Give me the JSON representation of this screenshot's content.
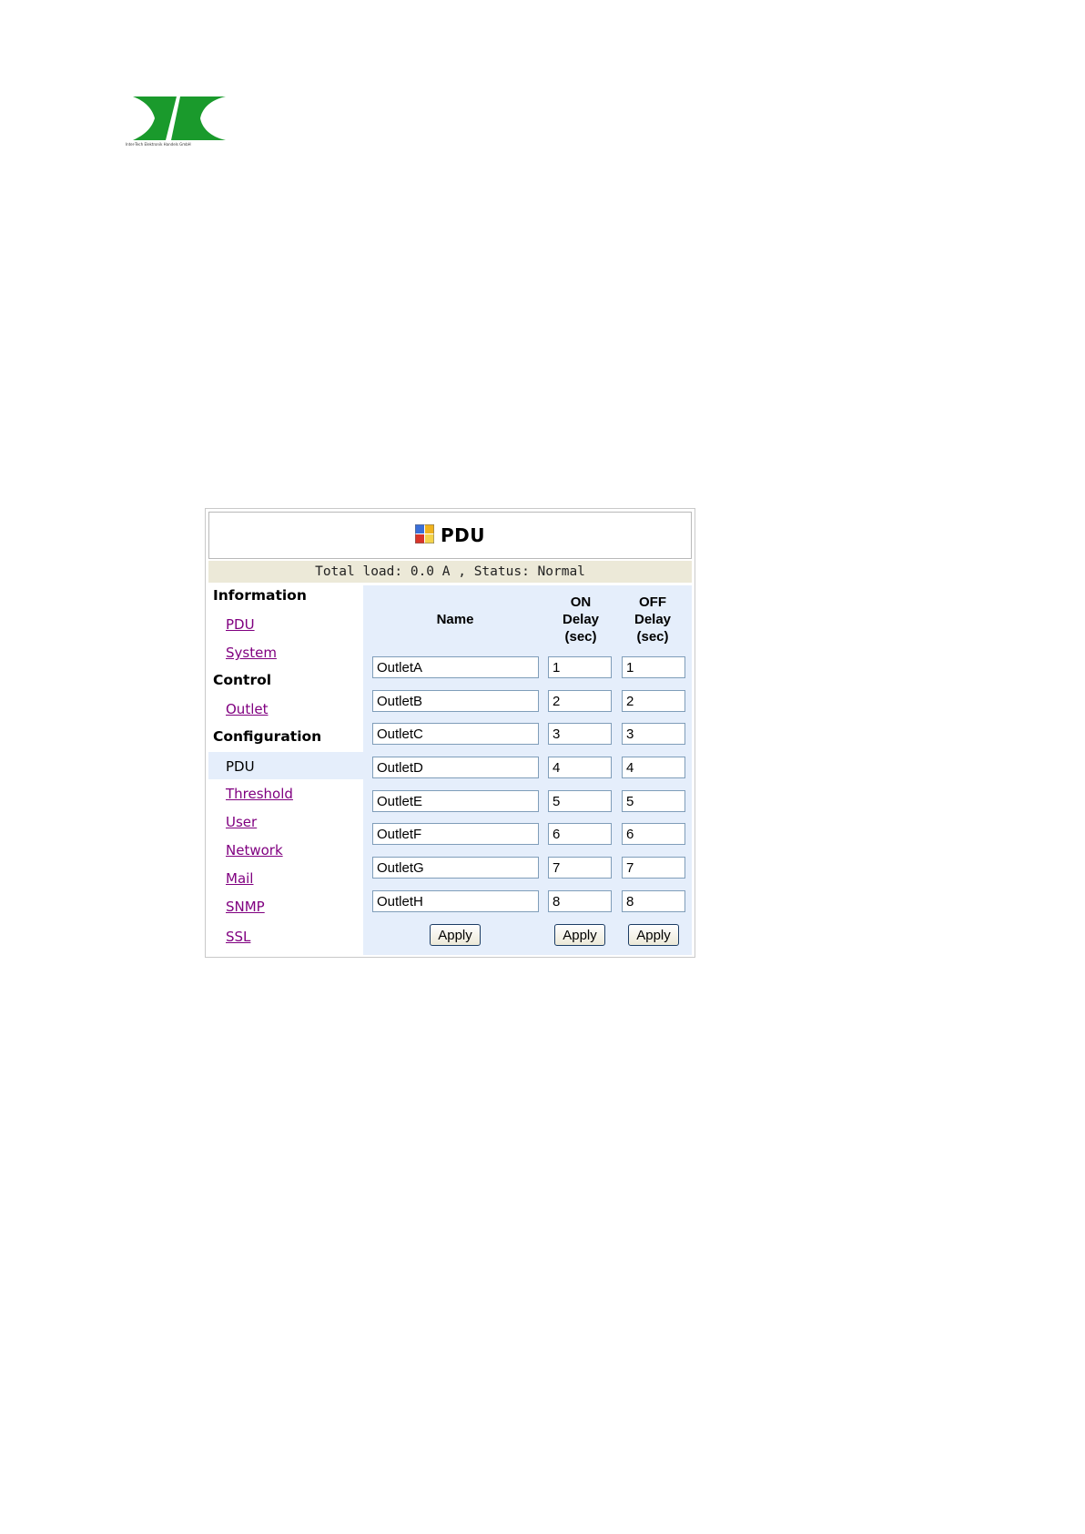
{
  "logo": {
    "caption": "Inter-Tech Elektronik Handels GmbH",
    "color": "#1a9a2c"
  },
  "header": {
    "title": "PDU",
    "icon": "pdu-color-grid-icon"
  },
  "status": {
    "text": "Total load: 0.0 A , Status: Normal"
  },
  "sidebar": {
    "information_heading": "Information",
    "information_links": [
      "PDU",
      "System"
    ],
    "control_heading": "Control",
    "control_links": [
      "Outlet"
    ],
    "configuration_heading": "Configuration",
    "configuration_current": "PDU",
    "configuration_links": [
      "Threshold",
      "User",
      "Network",
      "Mail",
      "SNMP",
      "SSL"
    ]
  },
  "table": {
    "col_name": "Name",
    "col_on_delay": [
      "ON",
      "Delay",
      "(sec)"
    ],
    "col_off_delay": [
      "OFF",
      "Delay",
      "(sec)"
    ],
    "rows": [
      {
        "name": "OutletA",
        "on_delay": "1",
        "off_delay": "1"
      },
      {
        "name": "OutletB",
        "on_delay": "2",
        "off_delay": "2"
      },
      {
        "name": "OutletC",
        "on_delay": "3",
        "off_delay": "3"
      },
      {
        "name": "OutletD",
        "on_delay": "4",
        "off_delay": "4"
      },
      {
        "name": "OutletE",
        "on_delay": "5",
        "off_delay": "5"
      },
      {
        "name": "OutletF",
        "on_delay": "6",
        "off_delay": "6"
      },
      {
        "name": "OutletG",
        "on_delay": "7",
        "off_delay": "7"
      },
      {
        "name": "OutletH",
        "on_delay": "8",
        "off_delay": "8"
      }
    ],
    "apply_name_label": "Apply",
    "apply_on_label": "Apply",
    "apply_off_label": "Apply"
  },
  "colors": {
    "link": "#800080",
    "status_bg": "#ece9d8",
    "content_bg": "#e5eefb"
  }
}
